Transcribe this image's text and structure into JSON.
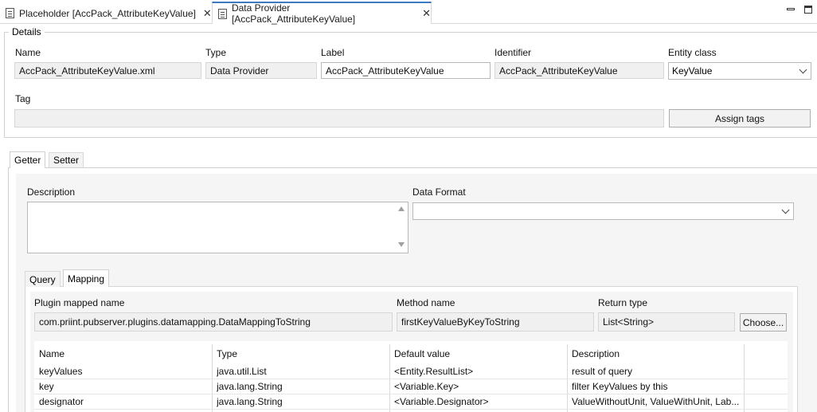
{
  "tabs": [
    {
      "label": "Placeholder [AccPack_AttributeKeyValue]",
      "close": "✕"
    },
    {
      "label": "Data Provider [AccPack_AttributeKeyValue]",
      "close": "✕"
    }
  ],
  "details": {
    "title": "Details",
    "name_label": "Name",
    "name_value": "AccPack_AttributeKeyValue.xml",
    "type_label": "Type",
    "type_value": "Data Provider",
    "label_label": "Label",
    "label_value": "AccPack_AttributeKeyValue",
    "identifier_label": "Identifier",
    "identifier_value": "AccPack_AttributeKeyValue",
    "entity_class_label": "Entity class",
    "entity_class_value": "KeyValue",
    "tag_label": "Tag",
    "tag_value": "",
    "assign_tags_button": "Assign tags"
  },
  "outer_tabs": {
    "getter": "Getter",
    "setter": "Setter"
  },
  "getter": {
    "description_label": "Description",
    "description_value": "",
    "data_format_label": "Data Format",
    "data_format_value": ""
  },
  "inner_tabs": {
    "query": "Query",
    "mapping": "Mapping"
  },
  "mapping": {
    "plugin_label": "Plugin mapped name",
    "plugin_value": "com.priint.pubserver.plugins.datamapping.DataMappingToString",
    "method_label": "Method name",
    "method_value": "firstKeyValueByKeyToString",
    "return_label": "Return type",
    "return_value": "List<String>",
    "choose_button": "Choose...",
    "columns": [
      "Name",
      "Type",
      "Default value",
      "Description"
    ],
    "rows": [
      {
        "name": "keyValues",
        "type": "java.util.List",
        "default": "<Entity.ResultList>",
        "description": "result of query"
      },
      {
        "name": "key",
        "type": "java.lang.String",
        "default": "<Variable.Key>",
        "description": "filter KeyValues by this"
      },
      {
        "name": "designator",
        "type": "java.lang.String",
        "default": "<Variable.Designator>",
        "description": "ValueWithoutUnit, ValueWithUnit, Lab..."
      }
    ]
  }
}
